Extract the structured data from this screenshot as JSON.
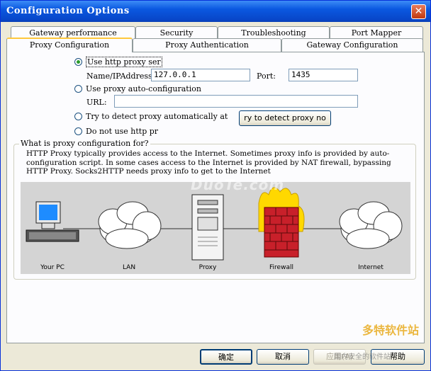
{
  "window": {
    "title": "Configuration Options",
    "close_glyph": "✕"
  },
  "tabs": {
    "row1": [
      "Gateway performance",
      "Security",
      "Troubleshooting",
      "Port Mapper"
    ],
    "row2": [
      "Proxy Configuration",
      "Proxy Authentication",
      "Gateway Configuration"
    ],
    "active": "Proxy Configuration"
  },
  "proxy": {
    "opt_http": "Use http proxy ser",
    "name_label": "Name/IPAddress",
    "name_value": "127.0.0.1",
    "port_label": "Port:",
    "port_value": "1435",
    "opt_auto": "Use proxy auto-configuration",
    "url_label": "URL:",
    "url_value": "",
    "opt_detect": "Try to detect proxy automatically at",
    "detect_button": "ry to detect proxy no",
    "opt_none": "Do not use http pr",
    "selected": "opt_http"
  },
  "info": {
    "legend": "What is proxy configuration for?",
    "text": "HTTP Proxy typically provides access to the Internet. Sometimes proxy info is provided by auto-configuration script. In some cases access to the Internet is provided by NAT firewall, bypassing HTTP Proxy. Socks2HTTP needs proxy info to get to the Internet"
  },
  "diagram": {
    "labels": [
      "Your PC",
      "LAN",
      "Proxy",
      "Firewall",
      "Internet"
    ],
    "icons": [
      "computer-icon",
      "cloud-icon",
      "server-icon",
      "firewall-icon",
      "cloud-icon"
    ]
  },
  "footer": {
    "ok": "确定",
    "cancel": "取消",
    "apply": "应用(A)",
    "help": "帮助"
  },
  "watermark": {
    "site": "DuoTe.com",
    "brand": "多特软件站",
    "corner": "国内安全的软件站"
  },
  "colors": {
    "title_bar": "#0a58e0",
    "tab_highlight": "#ffc83c",
    "diagram_bg": "#d4d4d4"
  }
}
